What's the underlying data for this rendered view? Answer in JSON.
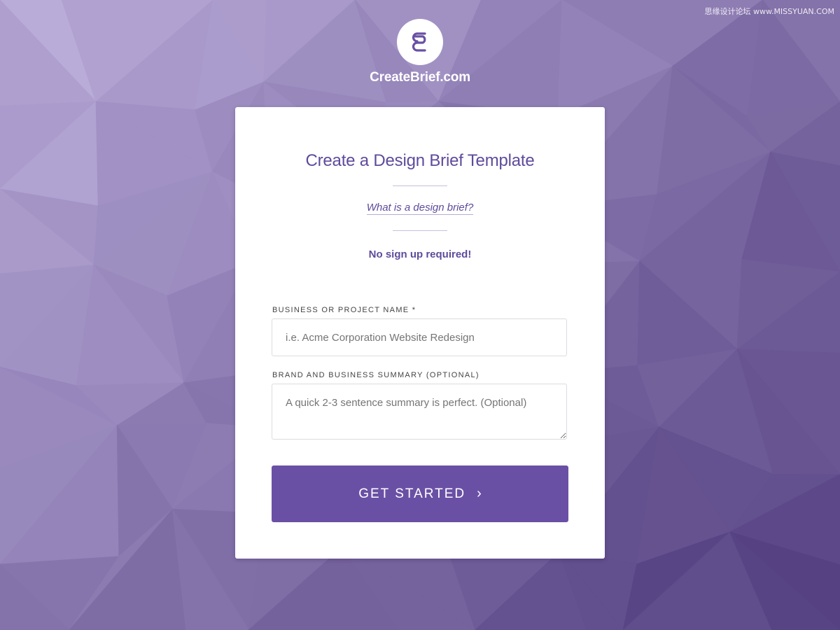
{
  "brand": {
    "name": "CreateBrief.com",
    "logo_icon": "brief-logo-icon"
  },
  "watermark": "思缘设计论坛 www.MISSYUAN.COM",
  "card": {
    "title": "Create a Design Brief Template",
    "help_link": "What is a design brief?",
    "note": "No sign up required!"
  },
  "form": {
    "project_name": {
      "label": "BUSINESS OR PROJECT NAME *",
      "value": "",
      "placeholder": "i.e. Acme Corporation Website Redesign"
    },
    "summary": {
      "label": "BRAND AND BUSINESS SUMMARY (OPTIONAL)",
      "value": "",
      "placeholder": "A quick 2-3 sentence summary is perfect. (Optional)"
    },
    "submit_label": "GET STARTED",
    "submit_icon": "chevron-right-icon"
  },
  "colors": {
    "accent": "#6a50a5",
    "title_text": "#5f4b9c",
    "background_light": "#bcaedb",
    "background_dark": "#4e3a7c"
  }
}
